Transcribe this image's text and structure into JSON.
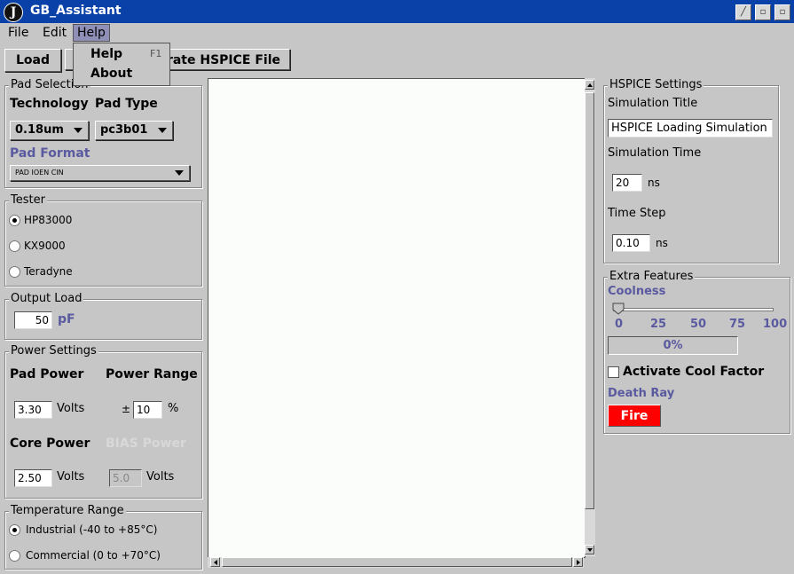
{
  "window": {
    "title": "GB_Assistant",
    "logo": "J"
  },
  "menu": {
    "file": "File",
    "edit": "Edit",
    "help": "Help"
  },
  "help_menu": {
    "items": [
      {
        "label": "Help",
        "shortcut": "F1"
      },
      {
        "label": "About"
      }
    ]
  },
  "toolbar": {
    "load": "Load",
    "generate_partial": "erate HSPICE File"
  },
  "pad_selection": {
    "title": "Pad Selection",
    "technology_label": "Technology",
    "pad_type_label": "Pad Type",
    "technology_value": "0.18um",
    "pad_type_value": "pc3b01",
    "pad_format_label": "Pad Format",
    "pad_format_value": "PAD IOEN CIN"
  },
  "tester": {
    "title": "Tester",
    "options": [
      "HP83000",
      "KX9000",
      "Teradyne"
    ],
    "selected": "HP83000"
  },
  "output_load": {
    "title": "Output Load",
    "value": "50",
    "unit": "pF"
  },
  "power_settings": {
    "title": "Power Settings",
    "pad_power_label": "Pad Power",
    "power_range_label": "Power Range",
    "pad_power_value": "3.30",
    "pad_power_unit": "Volts",
    "plus_minus": "±",
    "power_range_value": "10",
    "power_range_unit": "%",
    "core_power_label": "Core Power",
    "bias_power_label": "BIAS Power",
    "core_power_value": "2.50",
    "core_power_unit": "Volts",
    "bias_power_value": "5.0",
    "bias_power_unit": "Volts"
  },
  "temperature_range": {
    "title": "Temperature Range",
    "options": [
      "Industrial (-40 to +85°C)",
      "Commercial (0 to +70°C)"
    ],
    "selected": "Industrial (-40 to +85°C)"
  },
  "hspice_settings": {
    "title": "HSPICE Settings",
    "sim_title_label": "Simulation Title",
    "sim_title_value": "HSPICE Loading Simulation",
    "sim_time_label": "Simulation Time",
    "sim_time_value": "20",
    "sim_time_unit": "ns",
    "time_step_label": "Time Step",
    "time_step_value": "0.10",
    "time_step_unit": "ns"
  },
  "extra_features": {
    "title": "Extra Features",
    "coolness_label": "Coolness",
    "slider_ticks": [
      "0",
      "25",
      "50",
      "75",
      "100"
    ],
    "slider_value": 0,
    "progress_text": "0%",
    "progress_value": 0,
    "checkbox_label": "Activate Cool Factor",
    "checkbox_checked": false,
    "death_ray_label": "Death Ray",
    "fire_button": "Fire"
  },
  "colors": {
    "titlebar": "#0a41a8",
    "fire": "#ff0000",
    "accent_label": "#5a5aa0"
  }
}
